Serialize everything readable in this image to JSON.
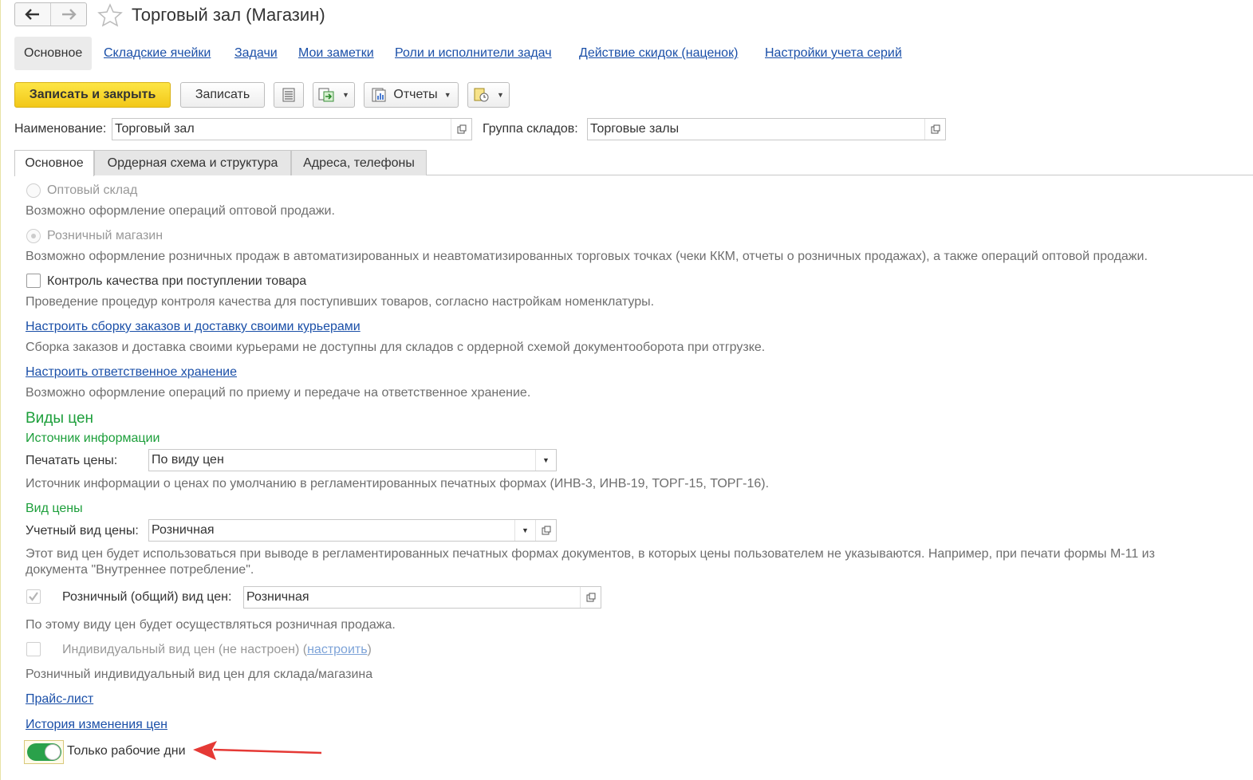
{
  "window": {
    "title": "Торговый зал (Магазин)"
  },
  "section_nav": {
    "items": [
      "Основное",
      "Складские ячейки",
      "Задачи",
      "Мои заметки",
      "Роли и исполнители задач",
      "Действие скидок (наценок)",
      "Настройки учета серий"
    ]
  },
  "toolbar": {
    "save_close_label": "Записать и закрыть",
    "save_label": "Записать",
    "reports_label": "Отчеты"
  },
  "header_fields": {
    "name_label": "Наименование:",
    "name_value": "Торговый зал",
    "group_label": "Группа складов:",
    "group_value": "Торговые залы"
  },
  "tabs": [
    "Основное",
    "Ордерная схема и структура",
    "Адреса, телефоны"
  ],
  "main": {
    "wholesale_radio": "Оптовый склад",
    "wholesale_desc": "Возможно оформление операций оптовой продажи.",
    "retail_radio": "Розничный магазин",
    "retail_desc": "Возможно оформление розничных продаж в автоматизированных и неавтоматизированных торговых точках (чеки ККМ, отчеты о розничных продажах), а также операций оптовой продажи.",
    "quality_checkbox": "Контроль качества при поступлении товара",
    "quality_desc": "Проведение процедур контроля качества для поступивших товаров, согласно настройкам номенклатуры.",
    "assembly_link": "Настроить сборку заказов и доставку своими курьерами",
    "assembly_desc": "Сборка заказов и доставка своими курьерами не доступны для складов с ордерной схемой документооборота при отгрузке.",
    "storage_link": "Настроить ответственное хранение",
    "storage_desc": "Возможно оформление операций по приему и передаче на ответственное хранение.",
    "prices_heading": "Виды цен",
    "source_heading": "Источник информации",
    "print_prices_label": "Печатать цены:",
    "print_prices_value": "По виду цен",
    "source_desc": "Источник информации о ценах по умолчанию в регламентированных печатных формах (ИНВ-3, ИНВ-19, ТОРГ-15, ТОРГ-16).",
    "price_type_heading": "Вид цены",
    "account_price_label": "Учетный вид цены:",
    "account_price_value": "Розничная",
    "account_price_desc_1": "Этот вид цен будет использоваться при выводе в регламентированных печатных формах документов, в которых цены пользователем не указываются. Например, при печати формы М-11 из",
    "account_price_desc_2": "документа \"Внутреннее потребление\".",
    "retail_general_label": "Розничный (общий) вид цен:",
    "retail_general_value": "Розничная",
    "retail_general_desc": "По этому виду цен будет осуществляться розничная продажа.",
    "individual_label": "Индивидуальный вид цен (не настроен) (",
    "individual_link": "настроить",
    "individual_close": ")",
    "individual_desc": "Розничный индивидуальный вид цен для склада/магазина",
    "price_list_link": "Прайс-лист",
    "price_history_link": "История изменения цен",
    "workdays_toggle": "Только рабочие дни"
  },
  "colors": {
    "accent_yellow": "#f5cf1e",
    "link_blue": "#1a4fa8",
    "heading_green": "#1d9f3b",
    "toggle_on": "#2aa14a",
    "arrow_red": "#e53935"
  }
}
